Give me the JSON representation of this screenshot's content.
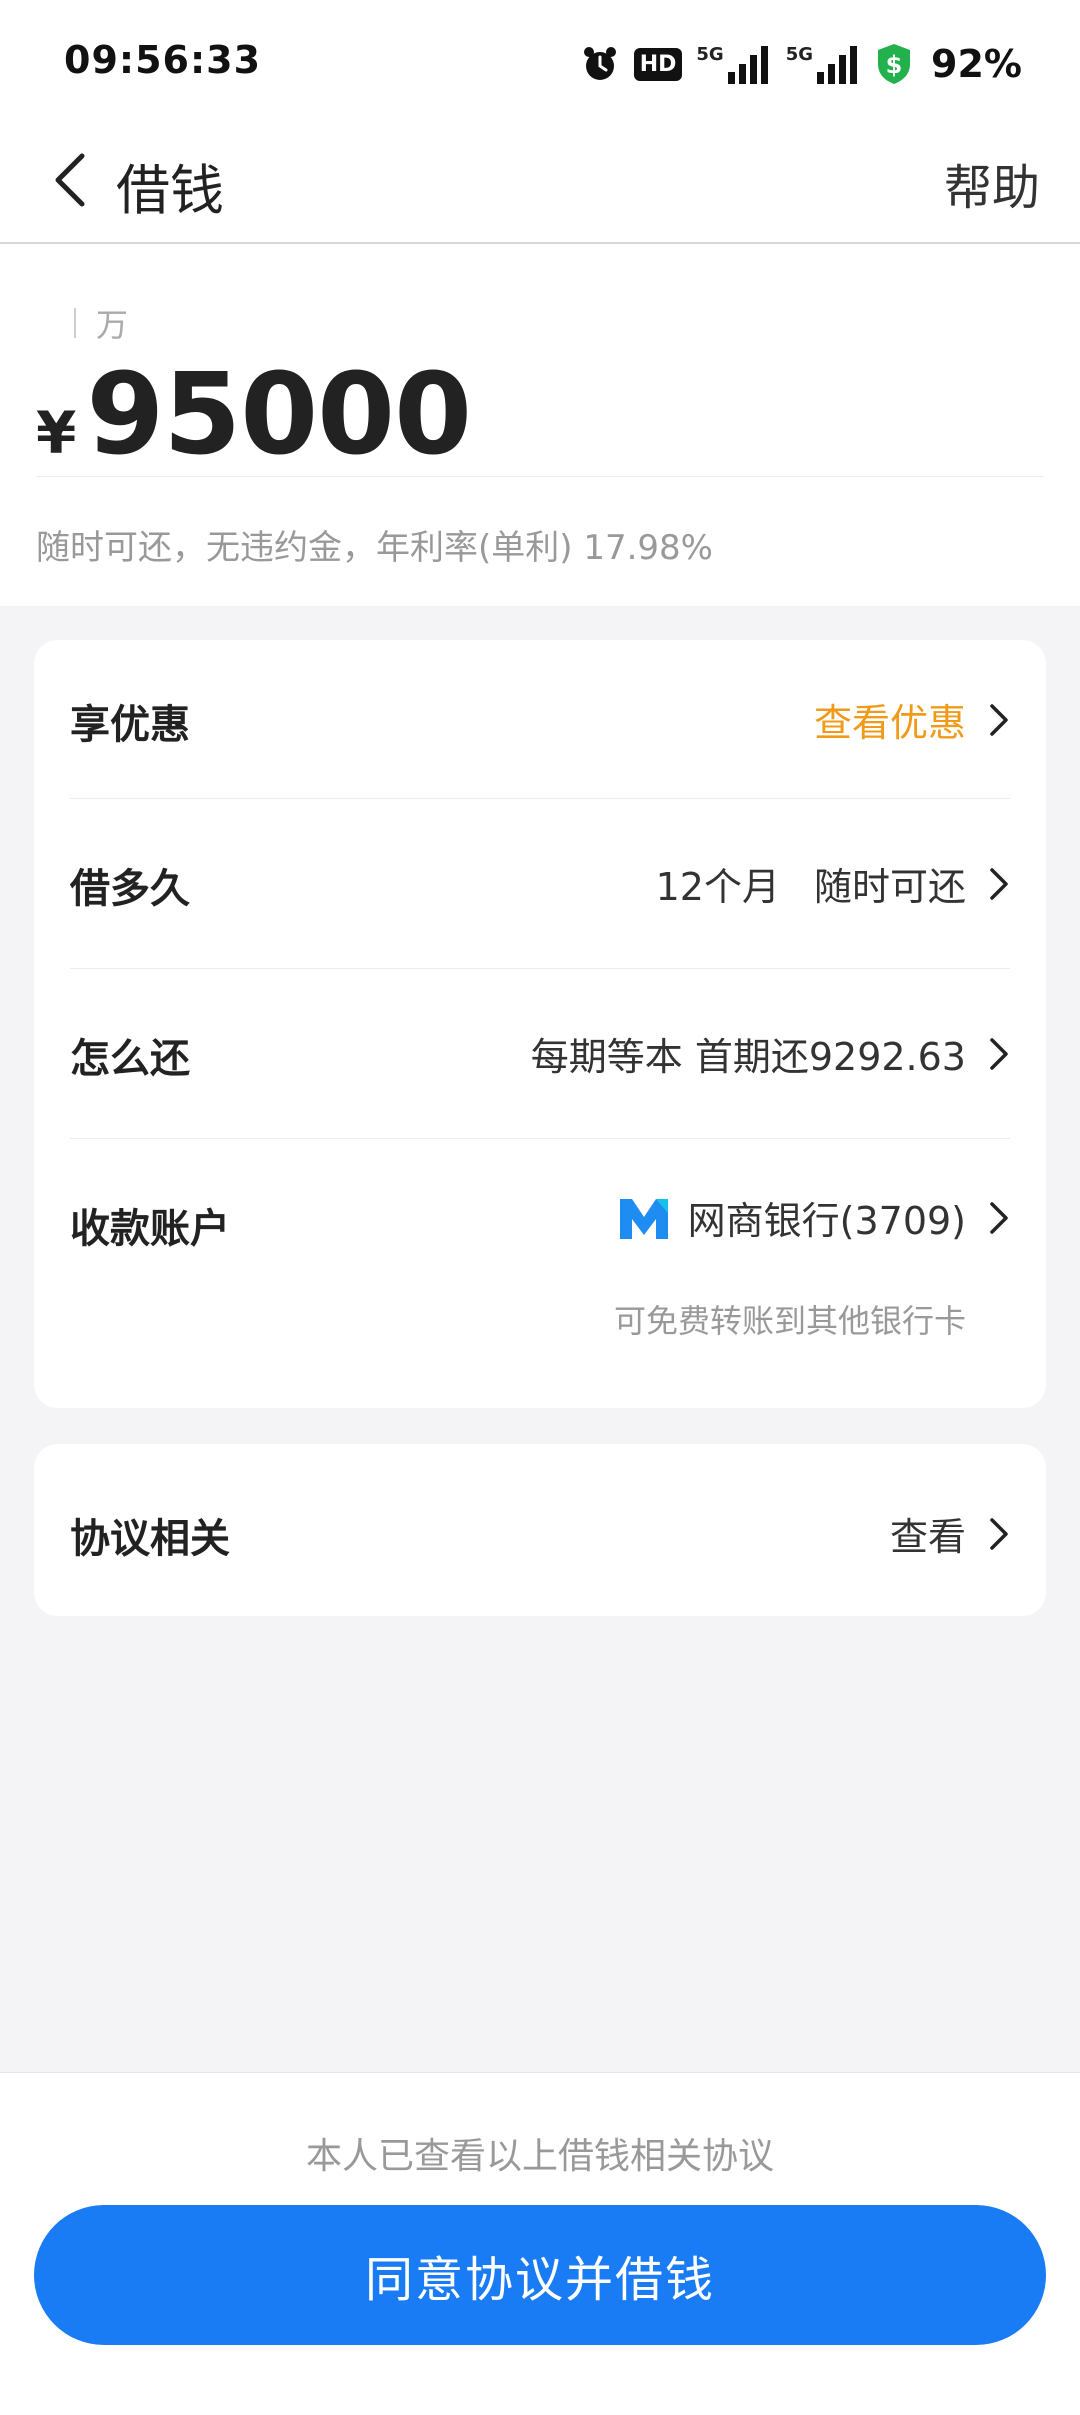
{
  "status_bar": {
    "time": "09:56:33",
    "hd_label": "HD",
    "net1_label": "5G",
    "net2_label": "5G",
    "battery": "92%"
  },
  "nav": {
    "title": "借钱",
    "help": "帮助"
  },
  "amount": {
    "unit": "万",
    "currency": "¥",
    "value": "95000",
    "note": "随时可还，无违约金，年利率(单利) 17.98%"
  },
  "rows": {
    "discount": {
      "label": "享优惠",
      "value": "查看优惠"
    },
    "duration": {
      "label": "借多久",
      "term": "12个月",
      "repay_anytime": "随时可还"
    },
    "repay": {
      "label": "怎么还",
      "value": "每期等本 首期还9292.63"
    },
    "account": {
      "label": "收款账户",
      "bank": "网商银行(3709)",
      "note": "可免费转账到其他银行卡"
    },
    "agreement": {
      "label": "协议相关",
      "value": "查看"
    }
  },
  "footer": {
    "note": "本人已查看以上借钱相关协议",
    "button": "同意协议并借钱"
  },
  "colors": {
    "accent": "#1a7cf5",
    "highlight": "#f09a1a",
    "battery_shield": "#22b14c",
    "bank_logo": "#1e8cf0"
  }
}
